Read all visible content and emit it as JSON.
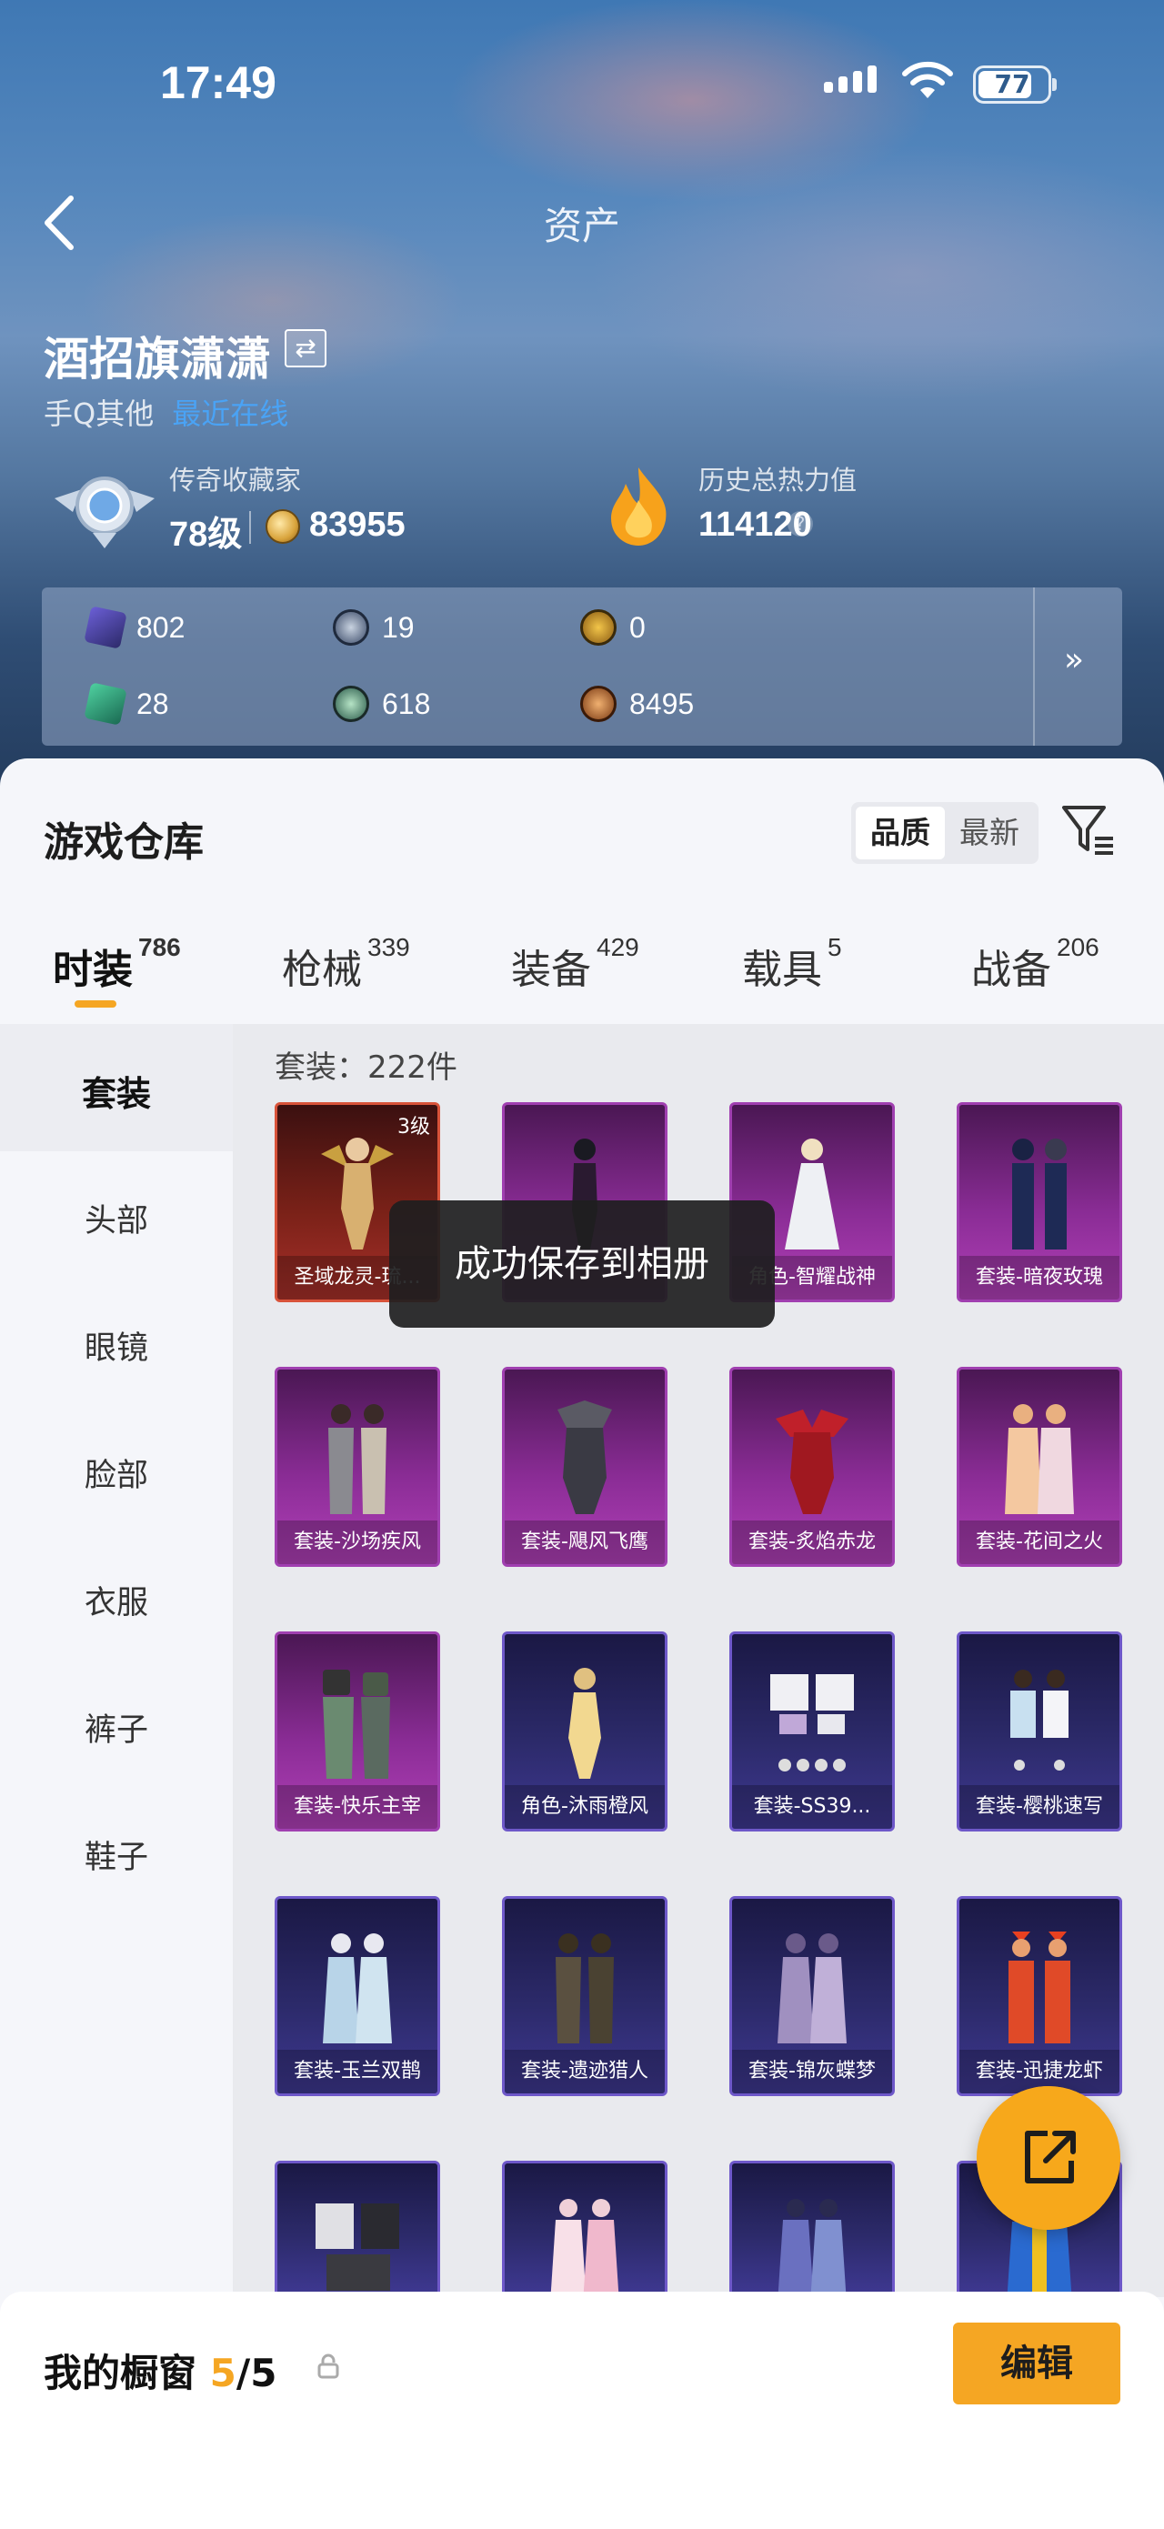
{
  "status_bar": {
    "time": "17:49",
    "battery": "77"
  },
  "nav": {
    "title": "资产"
  },
  "profile": {
    "name": "酒招旗潇潇",
    "platform": "手Q其他",
    "status_link": "最近在线",
    "rank_label": "传奇收藏家",
    "level": "78级",
    "collection_points": "83955",
    "heat_label": "历史总热力值",
    "heat_value": "114120"
  },
  "resources": {
    "row1": [
      {
        "icon": "card-icon",
        "value": "802"
      },
      {
        "icon": "ticket-icon",
        "value": "19"
      },
      {
        "icon": "medal-icon",
        "value": "0"
      }
    ],
    "row2": [
      {
        "icon": "green-card-icon",
        "value": "28"
      },
      {
        "icon": "gem-icon",
        "value": "618"
      },
      {
        "icon": "coin-icon",
        "value": "8495"
      }
    ]
  },
  "warehouse": {
    "title": "游戏仓库",
    "sort_options": [
      "品质",
      "最新"
    ],
    "tabs": [
      {
        "label": "时装",
        "count": "786"
      },
      {
        "label": "枪械",
        "count": "339"
      },
      {
        "label": "装备",
        "count": "429"
      },
      {
        "label": "载具",
        "count": "5"
      },
      {
        "label": "战备",
        "count": "206"
      }
    ],
    "categories": [
      "套装",
      "头部",
      "眼镜",
      "脸部",
      "衣服",
      "裤子",
      "鞋子"
    ],
    "count_text": "套装：222件",
    "items": [
      {
        "name": "圣域龙灵-琉...",
        "level": "3级"
      },
      {
        "name": ""
      },
      {
        "name": "角色-智耀战神"
      },
      {
        "name": "套装-暗夜玫瑰"
      },
      {
        "name": "套装-沙场疾风"
      },
      {
        "name": "套装-飓风飞鹰"
      },
      {
        "name": "套装-炙焰赤龙"
      },
      {
        "name": "套装-花间之火"
      },
      {
        "name": "套装-快乐主宰"
      },
      {
        "name": "角色-沐雨橙风"
      },
      {
        "name": "套装-SS39..."
      },
      {
        "name": "套装-樱桃速写"
      },
      {
        "name": "套装-玉兰双鹊"
      },
      {
        "name": "套装-遗迹猎人"
      },
      {
        "name": "套装-锦灰蝶梦"
      },
      {
        "name": "套装-迅捷龙虾"
      }
    ]
  },
  "toast": "成功保存到相册",
  "showcase": {
    "title": "我的橱窗",
    "count": "5",
    "total": "/5",
    "edit": "编辑"
  },
  "colors": {
    "accent": "#f5a623",
    "purple": "#a03fb0",
    "blue": "#6e58c9",
    "red": "#d8533a"
  }
}
